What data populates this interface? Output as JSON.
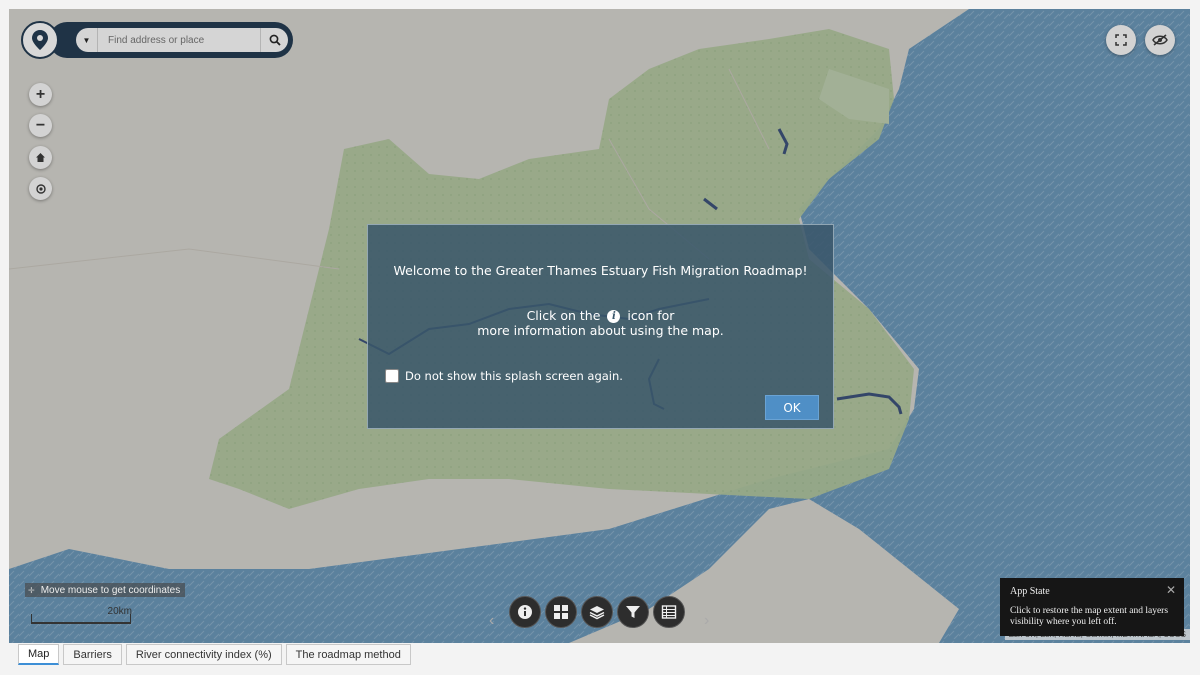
{
  "search": {
    "placeholder": "Find address or place"
  },
  "map_controls": {
    "zoom_in": "+",
    "zoom_out": "−"
  },
  "coordinates": {
    "text": "Move mouse to get coordinates"
  },
  "scale": {
    "label": "20km"
  },
  "attribution": {
    "text": "Esri UK, Esri, HERE, Garmin, METI/NASA, USGS"
  },
  "splash": {
    "title": "Welcome to the Greater Thames Estuary Fish Migration Roadmap!",
    "body_before_icon": "Click on the",
    "body_after_icon": "icon for",
    "body_line2": "more information about using the map.",
    "checkbox_label": "Do not show this splash screen again.",
    "checkbox_checked": false,
    "ok_label": "OK"
  },
  "app_state": {
    "title": "App State",
    "message": "Click to restore the map extent and layers visibility where you left off.",
    "close": "✕"
  },
  "toolbar": {
    "items": [
      "info-icon",
      "widgets-grid-icon",
      "layers-icon",
      "filter-icon",
      "table-icon"
    ],
    "prev": "‹",
    "next": "›"
  },
  "tabs": [
    {
      "label": "Map",
      "active": true
    },
    {
      "label": "Barriers",
      "active": false
    },
    {
      "label": "River connectivity index (%)",
      "active": false
    },
    {
      "label": "The roadmap method",
      "active": false
    }
  ],
  "colors": {
    "sea": "#4f8fbf",
    "land": "#ebe8e1",
    "catchment_green": "#b5d39a",
    "river": "#0b2a66",
    "splash_bg": "#39566a",
    "ok_button": "#4f8fc6",
    "search_bar": "#1f3346"
  }
}
